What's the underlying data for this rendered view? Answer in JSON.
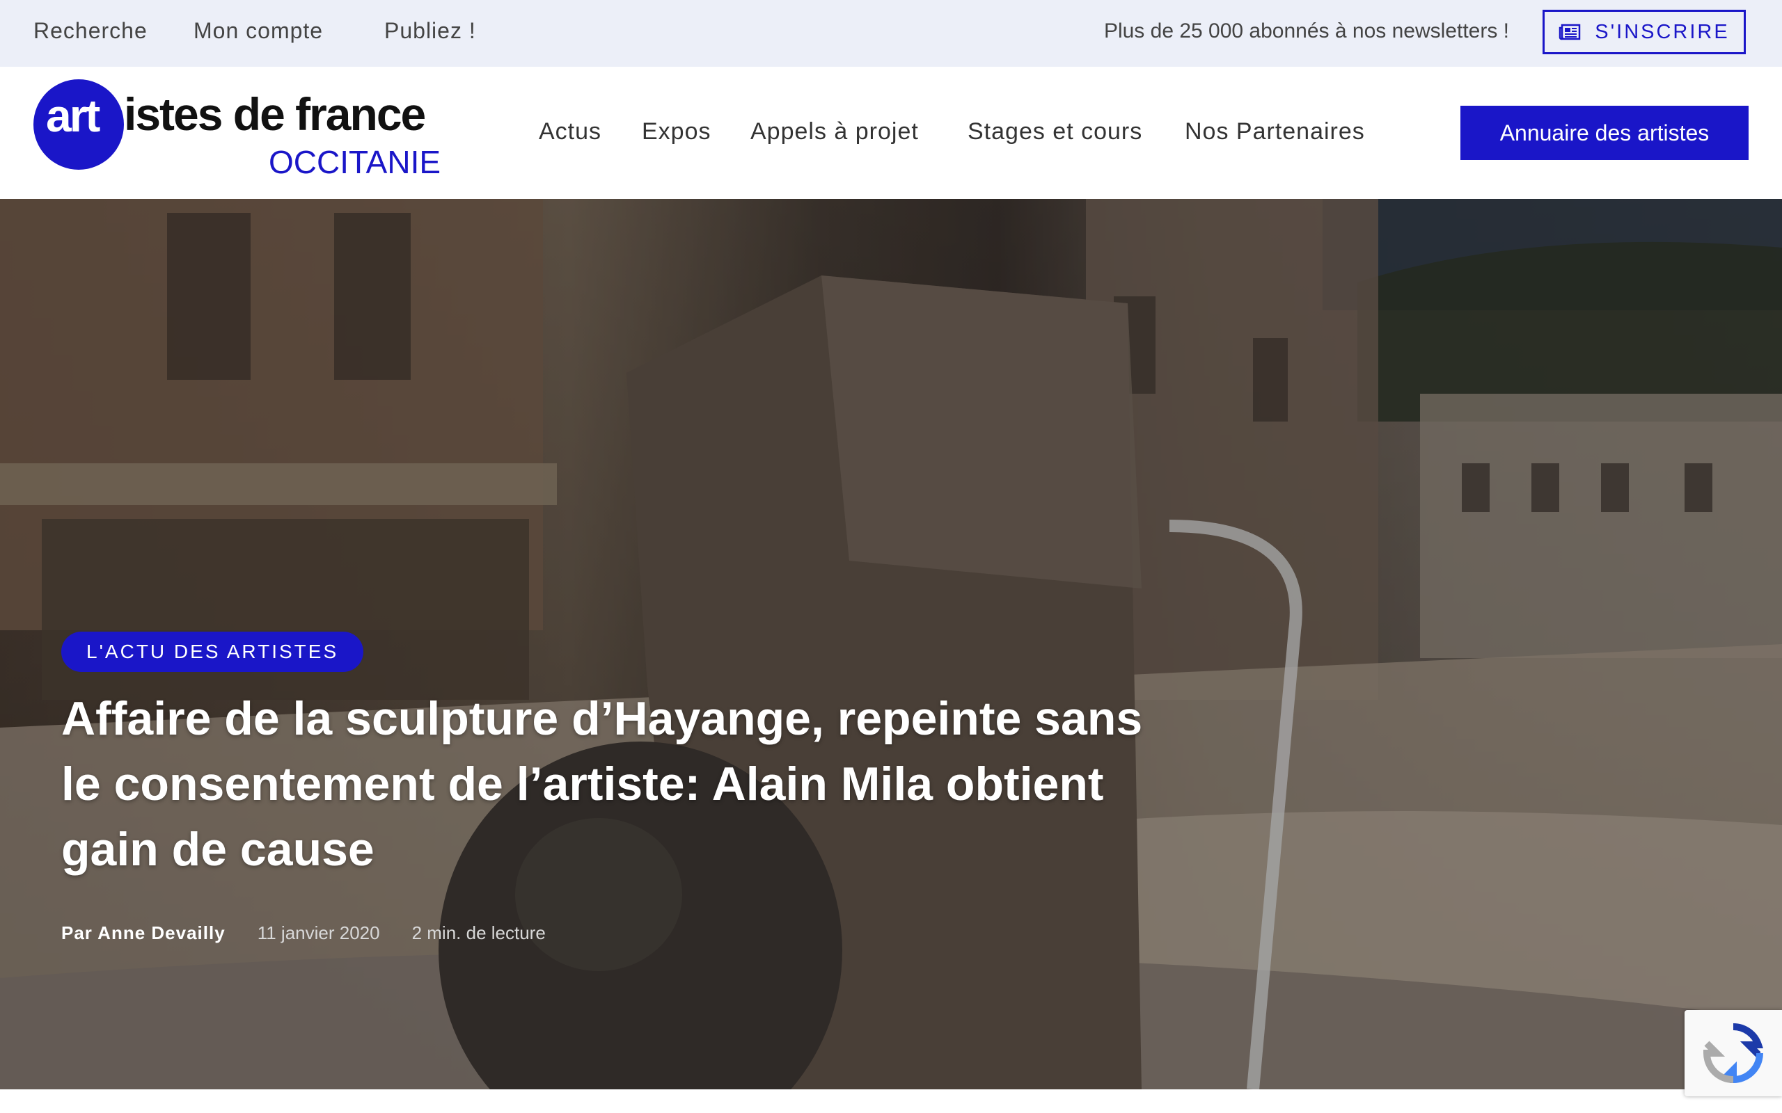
{
  "topbar": {
    "links": [
      "Recherche",
      "Mon compte",
      "Publiez !"
    ],
    "newsletter_text": "Plus de 25 000 abonnés à nos newsletters !",
    "subscribe_label": "S'INSCRIRE"
  },
  "logo": {
    "art": "art",
    "main": "istes de france",
    "region": "OCCITANIE"
  },
  "nav": {
    "items": [
      "Actus",
      "Expos",
      "Appels à projet",
      "Stages et cours",
      "Nos Partenaires"
    ],
    "directory_button": "Annuaire des artistes"
  },
  "article": {
    "category": "L'ACTU DES ARTISTES",
    "title": "Affaire de la sculpture d’Hayange, repeinte sans le consentement de l’artiste: Alain Mila obtient gain de cause",
    "author": "Par Anne Devailly",
    "date": "11 janvier 2020",
    "read_time": "2 min. de lecture"
  },
  "colors": {
    "brand": "#1a16c8",
    "topbar_bg": "#eceff8"
  },
  "icons": [
    "newspaper-icon",
    "recaptcha-icon"
  ]
}
